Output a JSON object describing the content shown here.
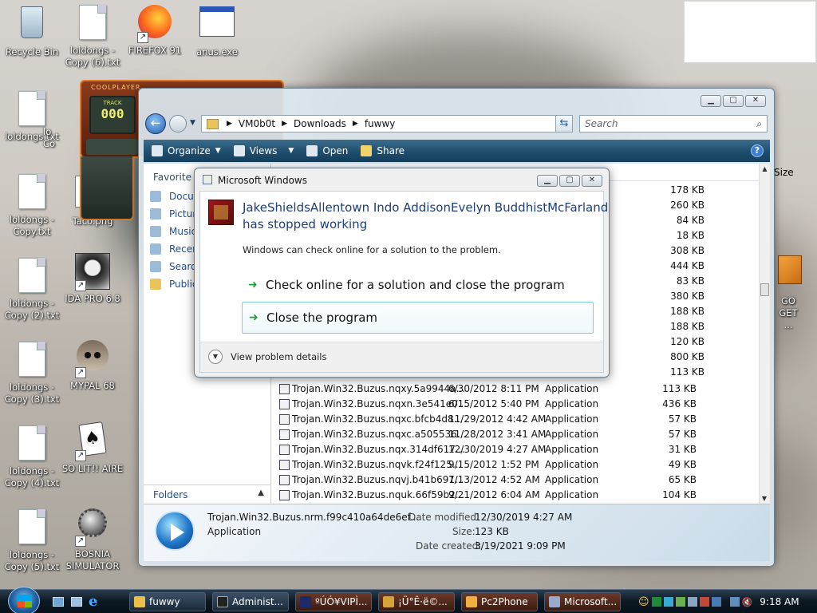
{
  "desktop": {
    "icons": [
      {
        "label": "Recycle Bin"
      },
      {
        "label": "loldongs - Copy (6).txt"
      },
      {
        "label": "FIREFOX 91"
      },
      {
        "label": "anus.exe"
      },
      {
        "label": "loldongs.txt"
      },
      {
        "label": "lo Co"
      },
      {
        "label": "loldongs - Copy.txt"
      },
      {
        "label": "Taco.png"
      },
      {
        "label": "loldongs - Copy (2).txt"
      },
      {
        "label": "IDA PRO 6.8"
      },
      {
        "label": "loldongs - Copy (3).txt"
      },
      {
        "label": "MYPAL 68"
      },
      {
        "label": "loldongs - Copy (4).txt"
      },
      {
        "label": "SO LIT!! AIRE"
      },
      {
        "label": "loldongs - Copy (5).txt"
      },
      {
        "label": "BOSNIA SIMULATOR"
      },
      {
        "label": "GO GET ..."
      }
    ],
    "coolplayer": {
      "title": "COOLPLAYER",
      "track_label": "TRACK",
      "track_value": "000"
    }
  },
  "explorer": {
    "address": [
      "VM0b0t",
      "Downloads",
      "fuwwy"
    ],
    "search_placeholder": "Search",
    "toolbar": {
      "organize": "Organize",
      "views": "Views",
      "open": "Open",
      "share": "Share"
    },
    "nav": {
      "favorite_links": "Favorite L",
      "items": [
        "Docun",
        "Pictur",
        "Music",
        "Recen",
        "Search",
        "Public"
      ],
      "folders": "Folders"
    },
    "columns": {
      "size": "Size"
    },
    "top_sizes": [
      "178 KB",
      "260 KB",
      "84 KB",
      "18 KB",
      "308 KB",
      "444 KB",
      "83 KB",
      "380 KB",
      "188 KB",
      "188 KB",
      "120 KB",
      "800 KB",
      "113 KB"
    ],
    "rows": [
      {
        "name": "Trojan.Win32.Buzus.nqxy.5a9944a...",
        "date": "6/30/2012 8:11 PM",
        "type": "Application",
        "size": "113 KB"
      },
      {
        "name": "Trojan.Win32.Buzus.nqxn.3e541e0...",
        "date": "6/15/2012 5:40 PM",
        "type": "Application",
        "size": "436 KB"
      },
      {
        "name": "Trojan.Win32.Buzus.nqxc.bfcb4d8...",
        "date": "11/29/2012 4:42 AM",
        "type": "Application",
        "size": "57 KB"
      },
      {
        "name": "Trojan.Win32.Buzus.nqxc.a505536...",
        "date": "11/28/2012 3:41 AM",
        "type": "Application",
        "size": "57 KB"
      },
      {
        "name": "Trojan.Win32.Buzus.nqx.314df617...",
        "date": "12/30/2019 4:27 AM",
        "type": "Application",
        "size": "31 KB"
      },
      {
        "name": "Trojan.Win32.Buzus.nqvk.f24f125...",
        "date": "9/15/2012 1:52 PM",
        "type": "Application",
        "size": "49 KB"
      },
      {
        "name": "Trojan.Win32.Buzus.nqvj.b41b691...",
        "date": "7/13/2012 4:52 AM",
        "type": "Application",
        "size": "65 KB"
      },
      {
        "name": "Trojan.Win32.Buzus.nquk.66f59b2...",
        "date": "9/21/2012 6:04 AM",
        "type": "Application",
        "size": "104 KB"
      }
    ],
    "details": {
      "filename": "Trojan.Win32.Buzus.nrm.f99c410a64de6ef...",
      "type": "Application",
      "modified_label": "Date modified:",
      "modified_value": "12/30/2019 4:27 AM",
      "size_label": "Size:",
      "size_value": "123 KB",
      "created_label": "Date created:",
      "created_value": "3/19/2021 9:09 PM"
    }
  },
  "dialog": {
    "title": "Microsoft Windows",
    "heading_line1": "JakeShieldsAllentown Indo AddisonEvelyn BuddhistMcFarland",
    "heading_line2": "has stopped working",
    "message": "Windows can check online for a solution to the problem.",
    "option1": "Check online for a solution and close the program",
    "option2": "Close the program",
    "details": "View problem details"
  },
  "taskbar": {
    "buttons": [
      "fuwwy",
      "Administ...",
      "ºÚÓ¥VIPÌ...",
      "¡Ü°Ê·ë©...",
      "Pc2Phone",
      "Microsoft..."
    ],
    "clock": "9:18 AM"
  },
  "colors": {
    "accent": "#1e4d6e",
    "link": "#1d4e8f",
    "arrow": "#1fa038"
  }
}
